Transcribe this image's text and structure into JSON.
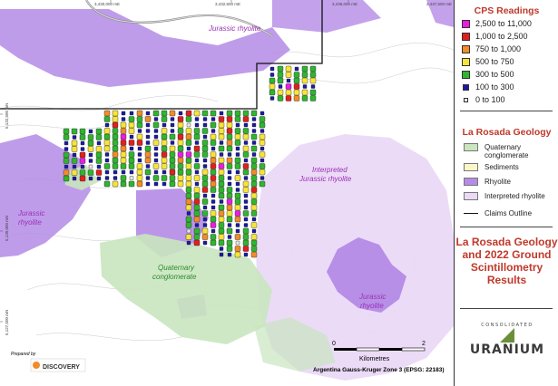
{
  "map": {
    "easting_labels": [
      "3,430,000 mE",
      "3,432,500 mE",
      "3,435,000 mE",
      "3,437,500 mE"
    ],
    "northing_labels": [
      "5,132,500 mN",
      "5,130,000 mN",
      "5,127,500 mN"
    ],
    "area_labels": {
      "jurassic_rhyolite_top": "Jurassic rhyolite",
      "jurassic_rhyolite_left": "Jurassic\nrhyolite",
      "interpreted_jurassic_rhyolite": "Interpreted\nJurassic rhyolite",
      "quaternary_conglomerate": "Quaternary\nconglomerate",
      "jurassic_rhyolite_center": "Jurassic\nrhyolite"
    },
    "scale_bar": {
      "min_label": "0",
      "max_label": "2",
      "units": "Kilometres",
      "projection": "Argentina Gauss-Kruger Zone 3 (EPSG: 22183)"
    },
    "prepared_by": "Prepared by",
    "prepared_by_company": "DISCOVERY"
  },
  "legend": {
    "cps_title": "CPS Readings",
    "cps_items": [
      {
        "label": "2,500 to 11,000",
        "color": "#e91ee0"
      },
      {
        "label": "1,000 to 2,500",
        "color": "#e0201e"
      },
      {
        "label": "750 to 1,000",
        "color": "#f28c28"
      },
      {
        "label": "500 to 750",
        "color": "#f7e43a"
      },
      {
        "label": "300 to 500",
        "color": "#2fb52f"
      },
      {
        "label": "100 to 300",
        "color": "#1a1aa8"
      },
      {
        "label": "0 to 100",
        "color": "#e8e8e8"
      }
    ],
    "geology_title": "La Rosada Geology",
    "geology_items": [
      {
        "label": "Quaternary\nconglomerate",
        "color": "#c9e6bf"
      },
      {
        "label": "Sediments",
        "color": "#fbf6c9"
      },
      {
        "label": "Rhyolite",
        "color": "#b48be6"
      },
      {
        "label": "Interpreted rhyolite",
        "color": "#ead9f7"
      }
    ],
    "claims_label": "Claims Outline"
  },
  "title": {
    "line1": "La Rosada Geology",
    "line2": "and 2022 Ground",
    "line3": "Scintillometry",
    "line4": "Results"
  },
  "logo": {
    "top": "CONSOLIDATED",
    "main": "URANIUM"
  }
}
